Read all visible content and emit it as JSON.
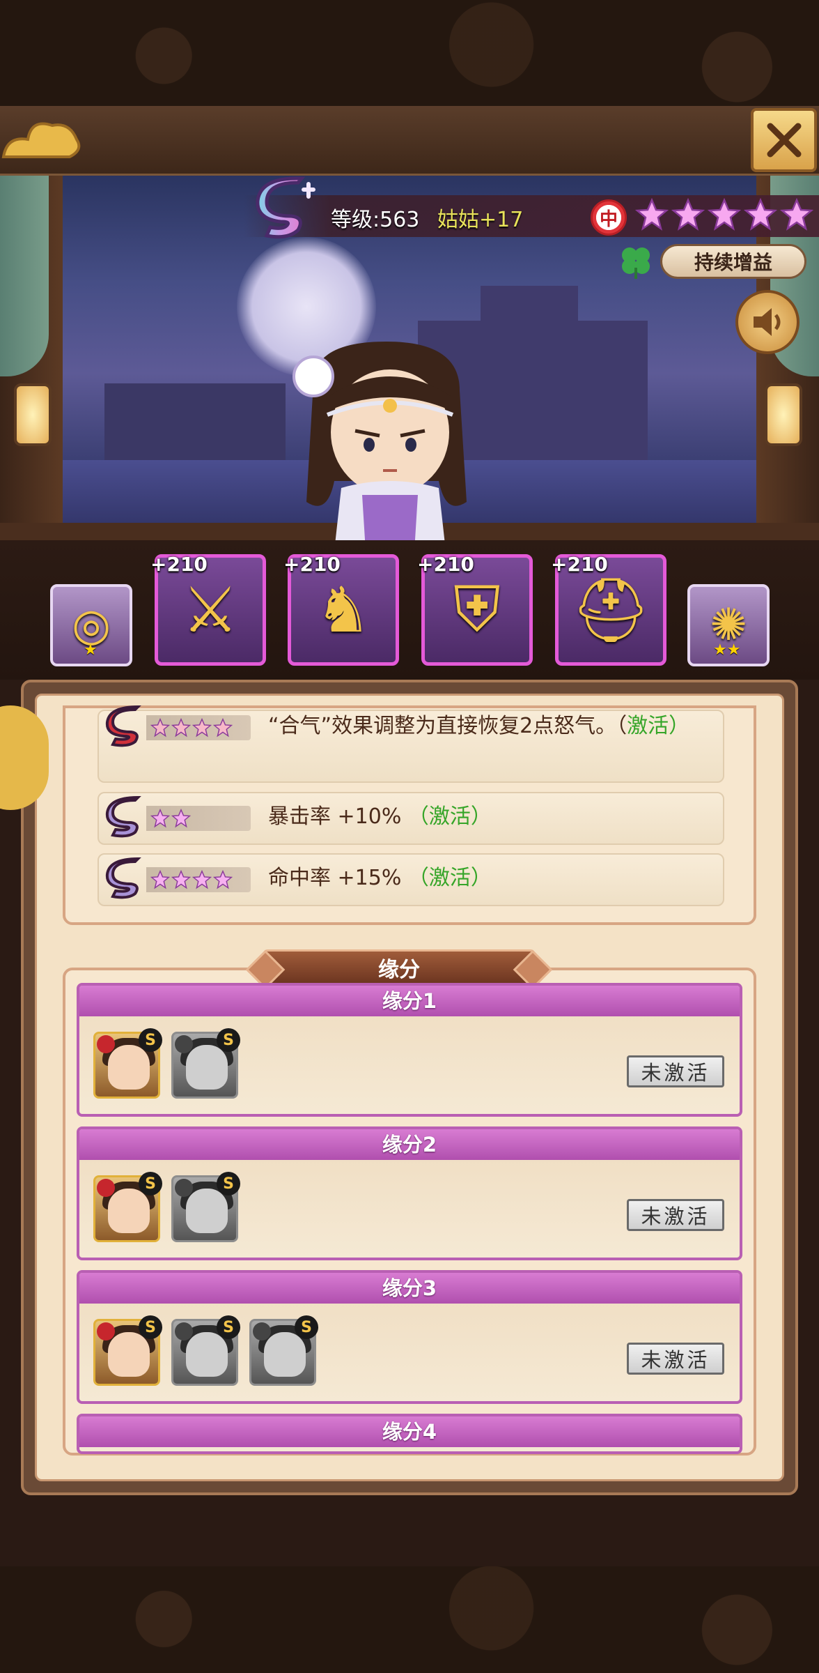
{
  "hero": {
    "level_text": "等级:563",
    "nickname": "姑姑+17",
    "faction": "中",
    "star_count": 5,
    "buff_label": "持续增益"
  },
  "equipment": [
    {
      "slot": "ring",
      "plus": "",
      "stars": "★"
    },
    {
      "slot": "weapon",
      "plus": "+210",
      "stars": ""
    },
    {
      "slot": "boots",
      "plus": "+210",
      "stars": ""
    },
    {
      "slot": "armor",
      "plus": "+210",
      "stars": ""
    },
    {
      "slot": "helmet",
      "plus": "+210",
      "stars": ""
    },
    {
      "slot": "amulet",
      "plus": "",
      "stars": "★★"
    }
  ],
  "effects": [
    {
      "stars": 4,
      "text": "“合气”效果调整为直接恢复2点怒气。（",
      "text2": "激活）",
      "active": true
    },
    {
      "stars": 2,
      "text": "暴击率 +10%",
      "status": "（激活）"
    },
    {
      "stars": 4,
      "text": "命中率 +15%",
      "status": "（激活）"
    }
  ],
  "fate": {
    "title": "缘分",
    "cards": [
      {
        "label": "缘分1",
        "status": "未激活"
      },
      {
        "label": "缘分2",
        "status": "未激活"
      },
      {
        "label": "缘分3",
        "status": "未激活"
      },
      {
        "label": "缘分4",
        "status": ""
      }
    ]
  },
  "colors": {
    "activated": "#35a528",
    "fate_header": "#c063bd",
    "nickname": "#e8e25a",
    "star": "#f7a8f0"
  }
}
